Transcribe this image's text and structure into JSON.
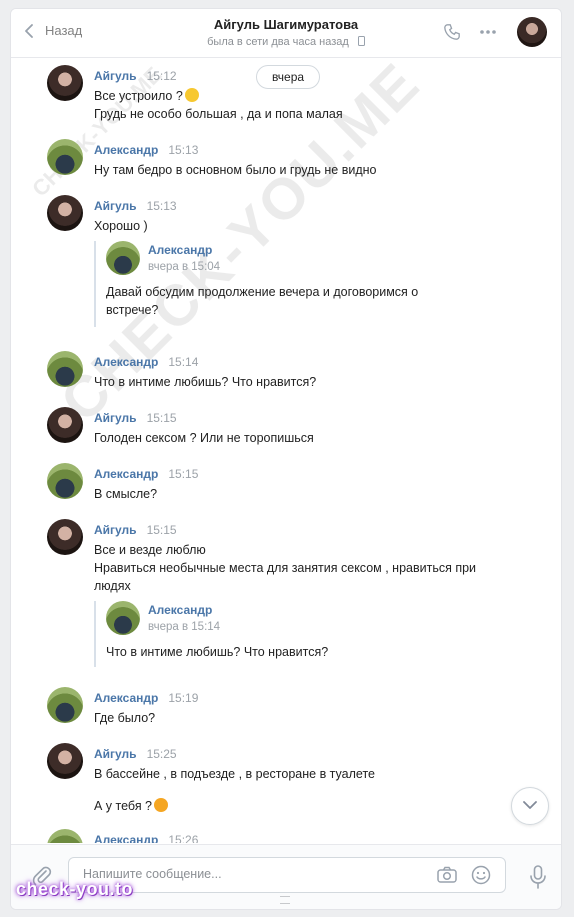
{
  "header": {
    "back_label": "Назад",
    "title": "Айгуль Шагимуратова",
    "status": "была в сети два часа назад"
  },
  "date_pill": "вчера",
  "messages": [
    {
      "author": "Айгуль",
      "time": "15:12",
      "text": "Все устроило ?",
      "text2": "Грудь не особо большая , да и попа малая",
      "avatar": "female"
    },
    {
      "author": "Александр",
      "time": "15:13",
      "text": "Ну там бедро в основном было и грудь не видно",
      "avatar": "male"
    },
    {
      "author": "Айгуль",
      "time": "15:13",
      "text": "Хорошо )",
      "avatar": "female",
      "forward": {
        "author": "Александр",
        "time": "вчера в 15:04",
        "text": "Давай обсудим продолжение вечера и договоримся о встрече?"
      }
    },
    {
      "author": "Александр",
      "time": "15:14",
      "text": "Что в интиме любишь? Что нравится?",
      "avatar": "male"
    },
    {
      "author": "Айгуль",
      "time": "15:15",
      "text": "Голоден сексом ? Или не торопишься",
      "avatar": "female"
    },
    {
      "author": "Александр",
      "time": "15:15",
      "text": "В смысле?",
      "avatar": "male"
    },
    {
      "author": "Айгуль",
      "time": "15:15",
      "text": "Все и везде люблю\nНравиться необычные места для занятия сексом , нравиться при людях",
      "avatar": "female",
      "forward": {
        "author": "Александр",
        "time": "вчера в 15:14",
        "text": "Что в интиме любишь? Что нравится?"
      }
    },
    {
      "author": "Александр",
      "time": "15:19",
      "text": "Где было?",
      "avatar": "male"
    },
    {
      "author": "Айгуль",
      "time": "15:25",
      "text": "В бассейне , в подъезде , в ресторане в туалете",
      "text2": "А у тебя ?",
      "avatar": "female"
    },
    {
      "author": "Александр",
      "time": "15:26",
      "text": "",
      "avatar": "male"
    }
  ],
  "composer": {
    "placeholder": "Напишите сообщение..."
  },
  "watermark": "CHECK-YOU.ME",
  "brand": "check-you.to",
  "icons": [
    "chevron-left-icon",
    "phone-icon",
    "more-dots-icon",
    "paperclip-icon",
    "camera-icon",
    "smile-icon",
    "mic-icon",
    "chevron-down-icon"
  ],
  "colors": {
    "accent": "#4a76a8",
    "muted": "#9ca2a8"
  }
}
